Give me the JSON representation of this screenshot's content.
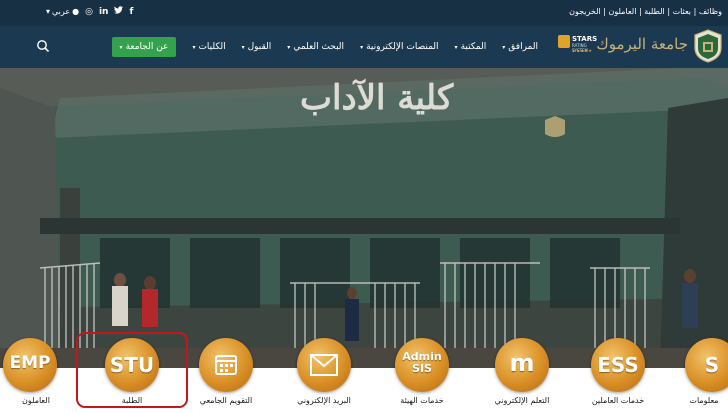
{
  "topbar": {
    "links": "وظائف | بعثات | الطلبة | العاملون | الخريجون",
    "lang_label": "عربي",
    "social": [
      {
        "icon": "instagram-icon",
        "glyph": "◎"
      },
      {
        "icon": "linkedin-icon",
        "glyph": "in"
      },
      {
        "icon": "twitter-icon",
        "glyph": "🐦"
      },
      {
        "icon": "facebook-icon",
        "glyph": "f"
      }
    ]
  },
  "navbar": {
    "logo_text": "جامعة اليرموك",
    "stars": {
      "label": "STARS",
      "sub": "RATING SYSTEM",
      "dots": "★★★★★"
    },
    "items": [
      {
        "label": "عن الجامعة",
        "primary": true
      },
      {
        "label": "الكليات",
        "primary": false
      },
      {
        "label": "القبول",
        "primary": false
      },
      {
        "label": "البحث العلمي",
        "primary": false
      },
      {
        "label": "المنصات الإلكترونية",
        "primary": false
      },
      {
        "label": "المكتبة",
        "primary": false
      },
      {
        "label": "المرافق",
        "primary": false
      }
    ],
    "caret": "▾",
    "accent_color": "#34a24c",
    "bar_color": "#1b3a52"
  },
  "hero": {
    "building_sign": "كلية الآداب"
  },
  "quick_links": [
    {
      "id": "staff",
      "code": "",
      "label": "العاملون"
    },
    {
      "id": "students",
      "code": "STU",
      "label": "الطلبة"
    },
    {
      "id": "calendar",
      "code": "",
      "label": "التقويم الجامعي"
    },
    {
      "id": "email",
      "code": "",
      "label": "البريد الإلكتروني"
    },
    {
      "id": "admin-sis",
      "code": "Admin SIS",
      "label": "خدمات الهيئة"
    },
    {
      "id": "elearning",
      "code": "m",
      "label": "التعلم الإلكتروني"
    },
    {
      "id": "ess",
      "code": "ESS",
      "label": "خدمات العاملين"
    },
    {
      "id": "info",
      "code": "S",
      "label": "معلومات"
    }
  ],
  "emp_code": "EMP",
  "highlight_color": "#c5161d"
}
